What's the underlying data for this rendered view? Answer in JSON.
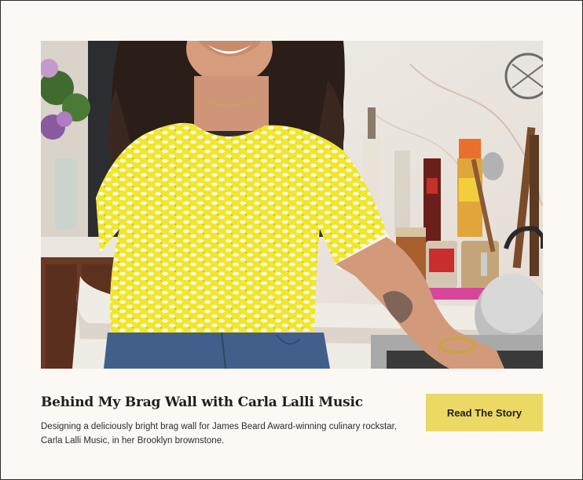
{
  "card": {
    "image_alt": "Woman in a yellow and white crochet top standing in a kitchen",
    "title": "Behind My Brag Wall with Carla Lalli Music",
    "description": "Designing a deliciously bright brag wall for James Beard Award-winning culinary rockstar, Carla Lalli Music, in her Brooklyn brownstone.",
    "cta_label": "Read The Story"
  },
  "colors": {
    "background": "#fcf9f5",
    "cta_background": "#ecd964",
    "text": "#1e1e1e"
  }
}
